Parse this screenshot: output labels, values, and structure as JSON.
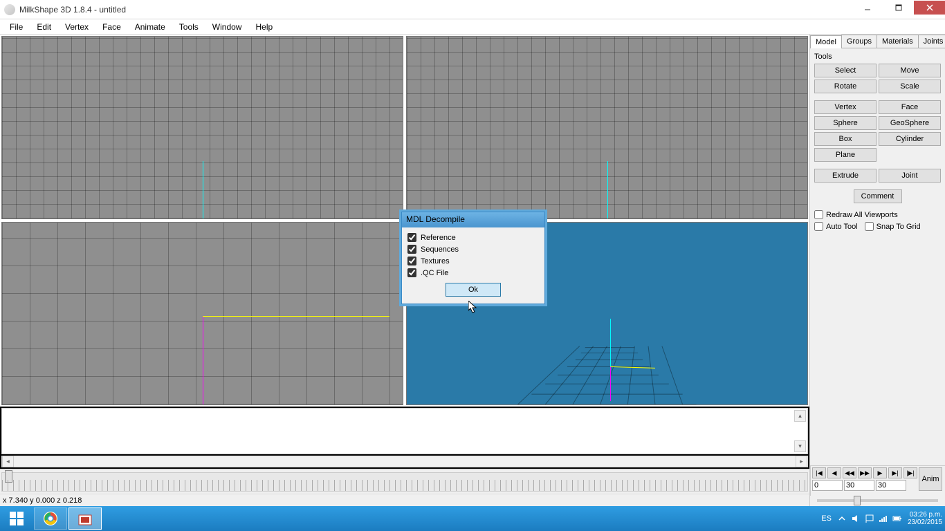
{
  "window": {
    "title": "MilkShape 3D 1.8.4 - untitled"
  },
  "menu": [
    "File",
    "Edit",
    "Vertex",
    "Face",
    "Animate",
    "Tools",
    "Window",
    "Help"
  ],
  "panel": {
    "tabs": [
      "Model",
      "Groups",
      "Materials",
      "Joints"
    ],
    "active_tab": "Model",
    "section_label": "Tools",
    "buttons_pair": [
      [
        "Select",
        "Move"
      ],
      [
        "Rotate",
        "Scale"
      ],
      [
        "Vertex",
        "Face"
      ],
      [
        "Sphere",
        "GeoSphere"
      ],
      [
        "Box",
        "Cylinder"
      ]
    ],
    "buttons_single_left": [
      "Plane"
    ],
    "buttons_pair2": [
      [
        "Extrude",
        "Joint"
      ]
    ],
    "comment_btn": "Comment",
    "checks": [
      {
        "label": "Redraw All Viewports",
        "checked": false
      },
      {
        "label": "Auto Tool",
        "checked": false
      },
      {
        "label": "Snap To Grid",
        "checked": false
      }
    ]
  },
  "dialog": {
    "title": "MDL Decompile",
    "options": [
      {
        "label": "Reference",
        "checked": true
      },
      {
        "label": "Sequences",
        "checked": true
      },
      {
        "label": "Textures",
        "checked": true
      },
      {
        "label": ".QC File",
        "checked": true
      }
    ],
    "ok": "Ok"
  },
  "anim": {
    "buttons": [
      "|◀",
      "◀",
      "◀◀",
      "▶▶",
      "▶",
      "▶|",
      "|▶|"
    ],
    "big": "Anim",
    "frame_start": "0",
    "frame_a": "30",
    "frame_b": "30"
  },
  "status": "x 7.340 y 0.000 z 0.218",
  "taskbar": {
    "lang": "ES",
    "time": "03:26 p.m.",
    "date": "23/02/2015"
  }
}
